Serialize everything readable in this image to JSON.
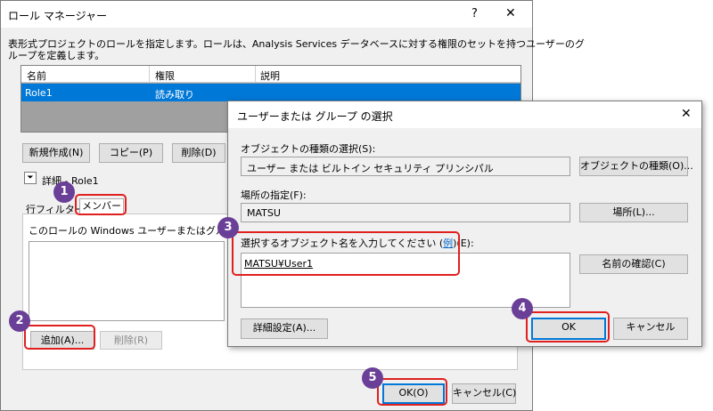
{
  "role_manager": {
    "title": "ロール マネージャー",
    "help_glyph": "?",
    "close_glyph": "✕",
    "description": "表形式プロジェクトのロールを指定します。ロールは、Analysis Services データベースに対する権限のセットを持つユーザーのグ",
    "description_line2": "ループを定義します。",
    "table_headers": [
      "名前",
      "権限",
      "説明"
    ],
    "rows": [
      {
        "name": "Role1",
        "permission": "読み取り",
        "description": ""
      }
    ],
    "btn_new": "新規作成(N)",
    "btn_copy": "コピー(P)",
    "btn_delete": "削除(D)",
    "details_label": "詳細 - Role1",
    "tab_row_filter": "行フィルター",
    "tab_members": "メンバー",
    "members_desc": "このロールの Windows ユーザーまたはグループを",
    "btn_add": "追加(A)...",
    "btn_remove": "削除(R)",
    "btn_ok": "OK(O)",
    "btn_cancel": "キャンセル(C)"
  },
  "select_dialog": {
    "title": "ユーザーまたは グループ の選択",
    "close_glyph": "✕",
    "object_type_label": "オブジェクトの種類の選択(S):",
    "object_type_value": "ユーザー または ビルトイン セキュリティ プリンシパル",
    "btn_object_types": "オブジェクトの種類(O)...",
    "location_label": "場所の指定(F):",
    "location_value": "MATSU",
    "btn_locations": "場所(L)...",
    "enter_names_label_pre": "選択するオブジェクト名を入力してください (",
    "enter_names_link": "例",
    "enter_names_label_post": ")(E):",
    "names_value": "MATSU¥User1",
    "btn_check_names": "名前の確認(C)",
    "btn_advanced": "詳細設定(A)...",
    "btn_ok": "OK",
    "btn_cancel": "キャンセル"
  },
  "callouts": [
    "1",
    "2",
    "3",
    "4",
    "5"
  ],
  "colors": {
    "selection": "#0078d7",
    "callout": "#6a3f97",
    "highlight": "#e02020"
  }
}
